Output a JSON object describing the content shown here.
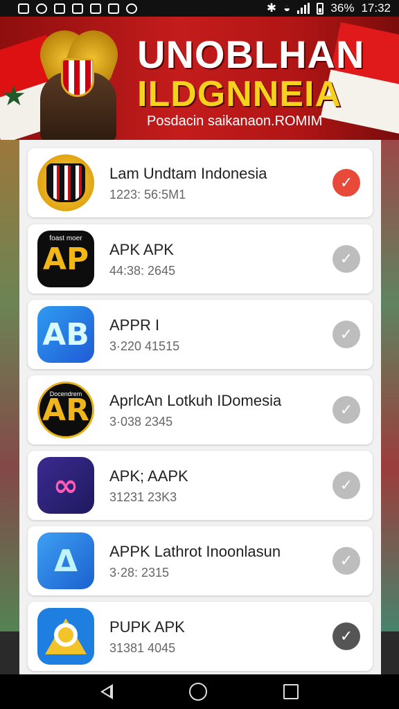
{
  "status_bar": {
    "battery": "36%",
    "time": "17:32"
  },
  "banner": {
    "title_line1": "UNOBLHAN",
    "title_line2": "ILDGNNEIA",
    "subtitle": "Posdacin saikanaon.ROMIM"
  },
  "apps": [
    {
      "name": "Lam Undtam Indonesia",
      "meta": "1223: 56:5M1",
      "icon": "striped-shield-logo-icon",
      "icon_text": "",
      "check": "red"
    },
    {
      "name": "APK APK",
      "meta": "44:38: 2645",
      "icon": "ap-logo-icon",
      "icon_text": "AP",
      "icon_small": "foast moer",
      "check": "grey"
    },
    {
      "name": "APPR I",
      "meta": "3·220 41515",
      "icon": "ap-outline-logo-icon",
      "icon_text": "AВ",
      "check": "grey"
    },
    {
      "name": "AprlcAn Lotkuh IDomesia",
      "meta": "3·038 2345",
      "icon": "ar-circle-logo-icon",
      "icon_text": "AR",
      "icon_small": "Docendrem",
      "check": "grey"
    },
    {
      "name": "APK; AAPK",
      "meta": "31231 23K3",
      "icon": "pink-ribbon-logo-icon",
      "icon_text": "∞",
      "check": "grey"
    },
    {
      "name": "APPK Lathrot Inoonlasun",
      "meta": "3·28: 2315",
      "icon": "triangle-logo-icon",
      "icon_text": "Δ",
      "check": "grey"
    },
    {
      "name": "PUPK APK",
      "meta": "31381 4045",
      "icon": "colorful-triangle-logo-icon",
      "icon_text": "",
      "check": "dark"
    }
  ],
  "check_symbol": "✓",
  "colors": {
    "banner_red": "#c41c1c",
    "title_yellow": "#f5d21e",
    "check_red": "#e84a3a",
    "check_grey": "#bdbdbd",
    "check_dark": "#555555"
  },
  "navbar": {
    "icons": [
      "back-icon",
      "home-icon",
      "recents-icon"
    ]
  }
}
